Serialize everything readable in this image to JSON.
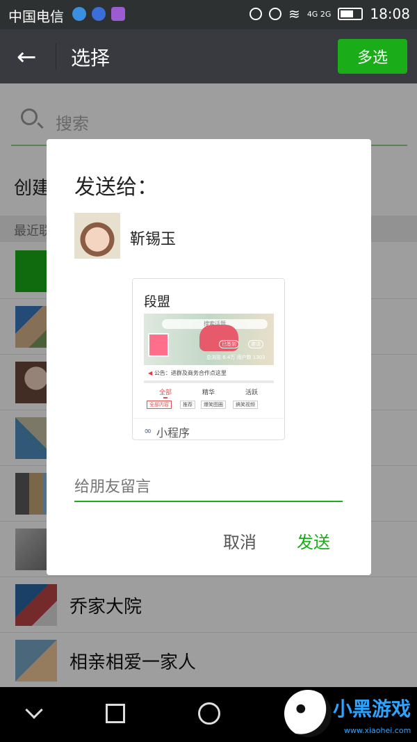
{
  "status_bar": {
    "carrier": "中国电信",
    "network": "4G 2G",
    "time": "18:08"
  },
  "nav": {
    "back_icon": "arrow-left-icon",
    "title": "选择",
    "multi_select": "多选"
  },
  "list": {
    "search_placeholder": "搜索",
    "create_label": "创建",
    "recent_label": "最近联",
    "rows": [
      {
        "name": ""
      },
      {
        "name": ""
      },
      {
        "name": ""
      },
      {
        "name": ""
      },
      {
        "name": ""
      },
      {
        "name": ""
      },
      {
        "name": "乔家大院"
      },
      {
        "name": "相亲相爱一家人"
      }
    ]
  },
  "dialog": {
    "title": "发送给：",
    "recipient": "靳锡玉",
    "card": {
      "title": "段盟",
      "search_hint": "搜索话题",
      "chip_signed": "已签到",
      "chip_invite": "邀请",
      "stats": "总浏览 6.4万   用户数 1303",
      "notice": "公告：进群及商务合作点这里",
      "tabs": [
        "全部",
        "精华",
        "活跃"
      ],
      "chips": [
        "全部内容",
        "推荐",
        "爆笑图圈",
        "搞笑视频"
      ],
      "footer_label": "小程序"
    },
    "message_placeholder": "给朋友留言",
    "cancel": "取消",
    "send": "发送"
  },
  "watermark": {
    "text": "小黑游戏",
    "url": "www.xiaohei.com"
  },
  "colors": {
    "accent": "#1aad19",
    "nav_bg": "#393a3f",
    "status_bg": "#2e3132"
  }
}
